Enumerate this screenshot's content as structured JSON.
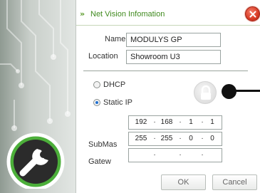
{
  "dialog": {
    "title": "Net Vision Infomation",
    "title_prefix": "»",
    "close_icon": "close-icon"
  },
  "fields": {
    "name_label": "Name",
    "name_value": "MODULYS GP",
    "location_label": "Location",
    "location_value": "Showroom U3"
  },
  "network": {
    "dhcp_label": "DHCP",
    "dhcp_selected": false,
    "static_label": "Static IP",
    "static_selected": true,
    "lock_icon": "lock-icon",
    "ip": [
      "192",
      "168",
      "1",
      "1"
    ],
    "submask_label": "SubMas",
    "submask": [
      "255",
      "255",
      "0",
      "0"
    ],
    "gateway_label": "Gatew",
    "gateway": [
      "",
      "",
      "",
      ""
    ],
    "separator": "·"
  },
  "buttons": {
    "ok_label": "OK",
    "cancel_label": "Cancel"
  },
  "colors": {
    "accent_green": "#3f8a1e",
    "logo_green": "#4caf3a",
    "close_red": "#d73a24"
  }
}
